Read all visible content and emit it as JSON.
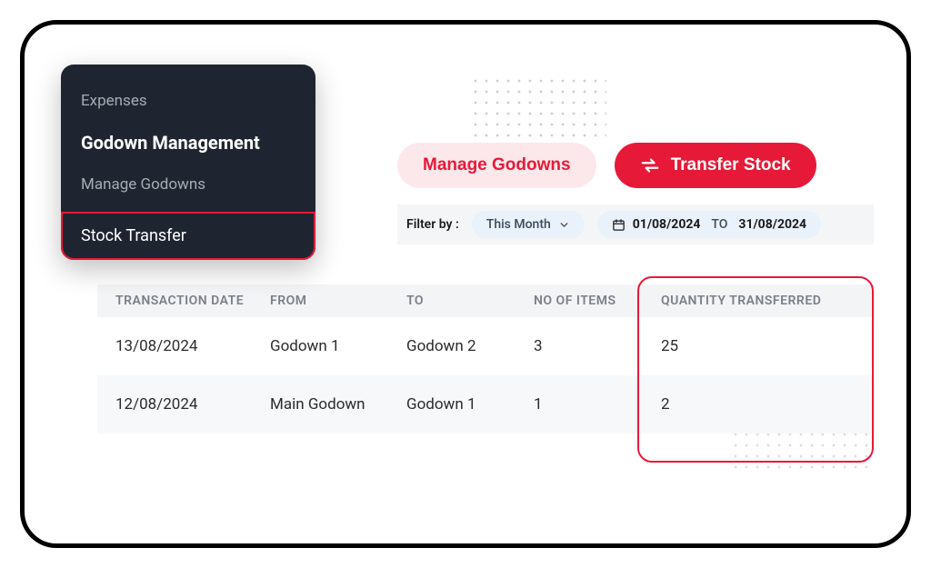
{
  "sidebar": {
    "items": [
      {
        "label": "Expenses"
      },
      {
        "label": "Godown Management"
      },
      {
        "label": "Manage Godowns"
      },
      {
        "label": "Stock Transfer"
      }
    ]
  },
  "actions": {
    "manage_label": "Manage Godowns",
    "transfer_label": "Transfer Stock"
  },
  "filter": {
    "label": "Filter by :",
    "period": "This Month",
    "from": "01/08/2024",
    "sep": "TO",
    "to": "31/08/2024"
  },
  "table": {
    "headers": [
      "TRANSACTION DATE",
      "FROM",
      "TO",
      "NO OF ITEMS",
      "QUANTITY TRANSFERRED"
    ],
    "rows": [
      {
        "date": "13/08/2024",
        "from": "Godown 1",
        "to": "Godown 2",
        "items": "3",
        "qty": "25"
      },
      {
        "date": "12/08/2024",
        "from": "Main Godown",
        "to": "Godown 1",
        "items": "1",
        "qty": "2"
      }
    ]
  }
}
